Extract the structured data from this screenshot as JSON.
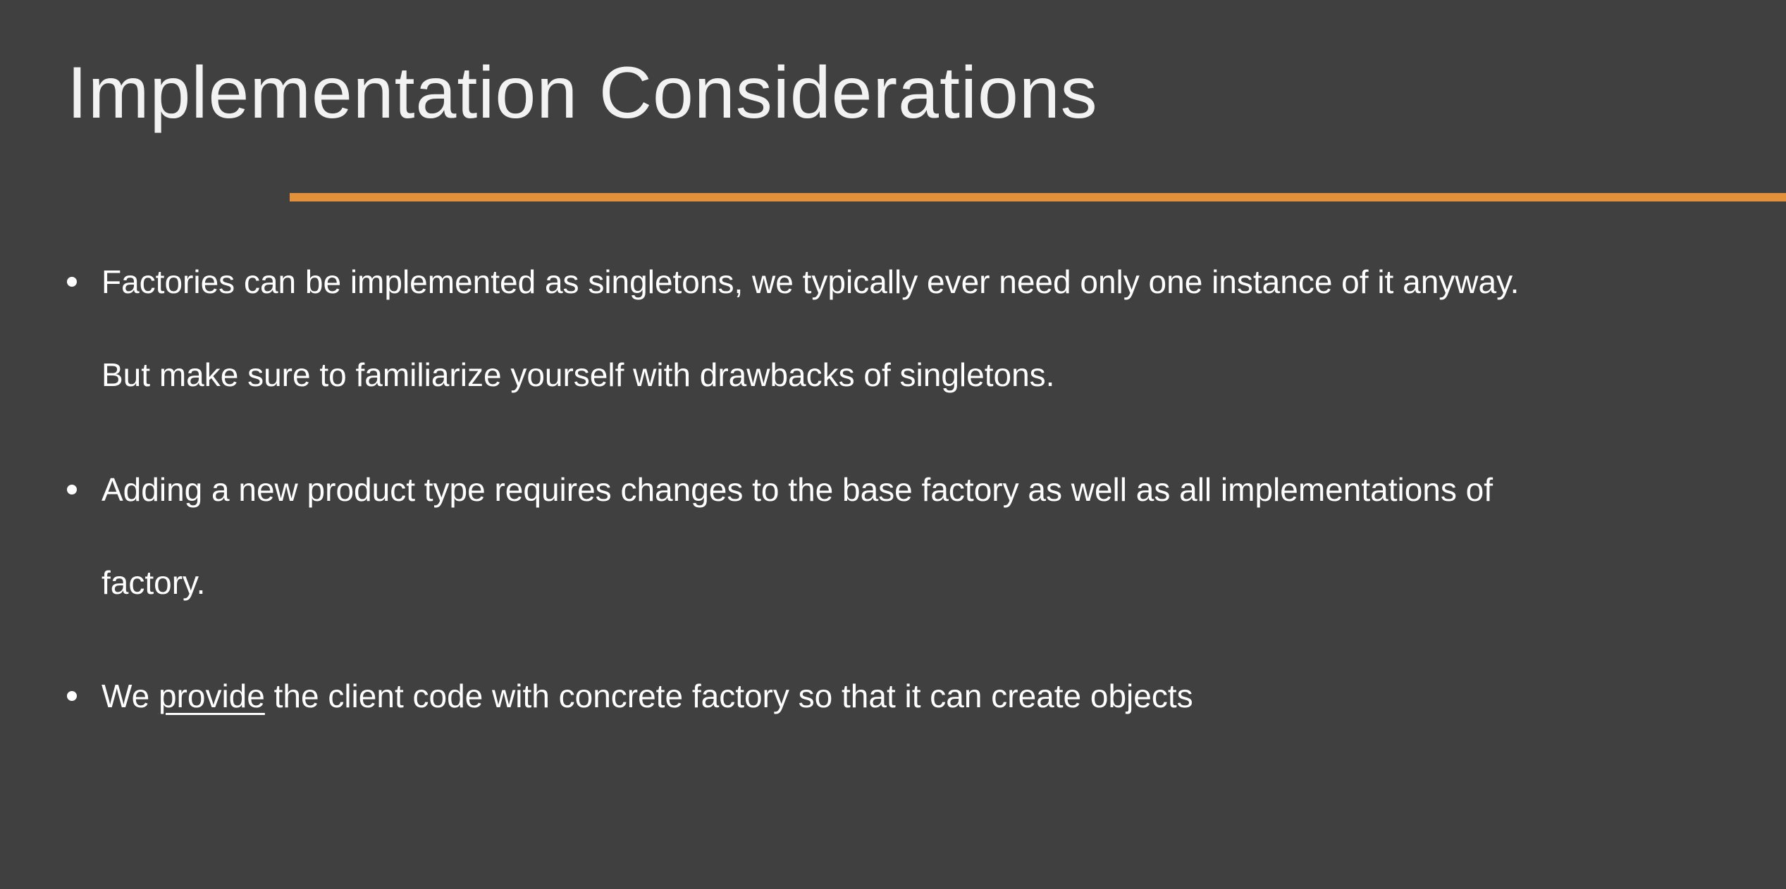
{
  "slide": {
    "title": "Implementation Considerations",
    "accent_color": "#e2913a",
    "background_color": "#404040",
    "bullets": [
      {
        "lines": [
          "Factories can be implemented as singletons, we typically ever need only one instance of it anyway.",
          "But make sure to familiarize yourself with drawbacks of singletons."
        ]
      },
      {
        "lines": [
          "Adding a new product type requires changes to the base factory as well as all implementations of",
          "factory."
        ]
      },
      {
        "prefix": "We",
        "link": "provide",
        "suffix": "the client code with concrete factory so that it can create objects"
      }
    ]
  }
}
